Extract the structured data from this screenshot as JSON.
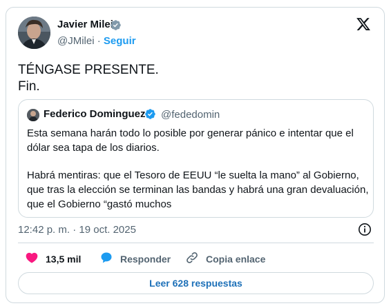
{
  "author": {
    "name": "Javier Milei",
    "handle": "@JMilei",
    "separator": "·",
    "follow_label": "Seguir"
  },
  "tweet": {
    "lines": [
      "TÉNGASE PRESENTE.",
      "Fin."
    ]
  },
  "quoted": {
    "name": "Federico Dominguez",
    "handle": "@fededomin",
    "paragraphs": [
      "Esta semana harán todo lo posible por generar pánico e intentar que el dólar sea tapa de los diarios.",
      "Habrá mentiras: que el Tesoro de EEUU “le suelta la mano” al Gobierno, que tras la elección se terminan las bandas y habrá una gran devaluación, que el Gobierno “gastó muchos"
    ]
  },
  "meta": {
    "timestamp": "12:42 p. m. · 19 oct. 2025"
  },
  "actions": {
    "likes": "13,5 mil",
    "reply_label": "Responder",
    "copy_label": "Copia enlace"
  },
  "footer": {
    "read_replies_label": "Leer 628 respuestas"
  },
  "colors": {
    "accent": "#1d9bf0",
    "like": "#f91880",
    "border": "#cfd9de",
    "muted": "#536471"
  }
}
